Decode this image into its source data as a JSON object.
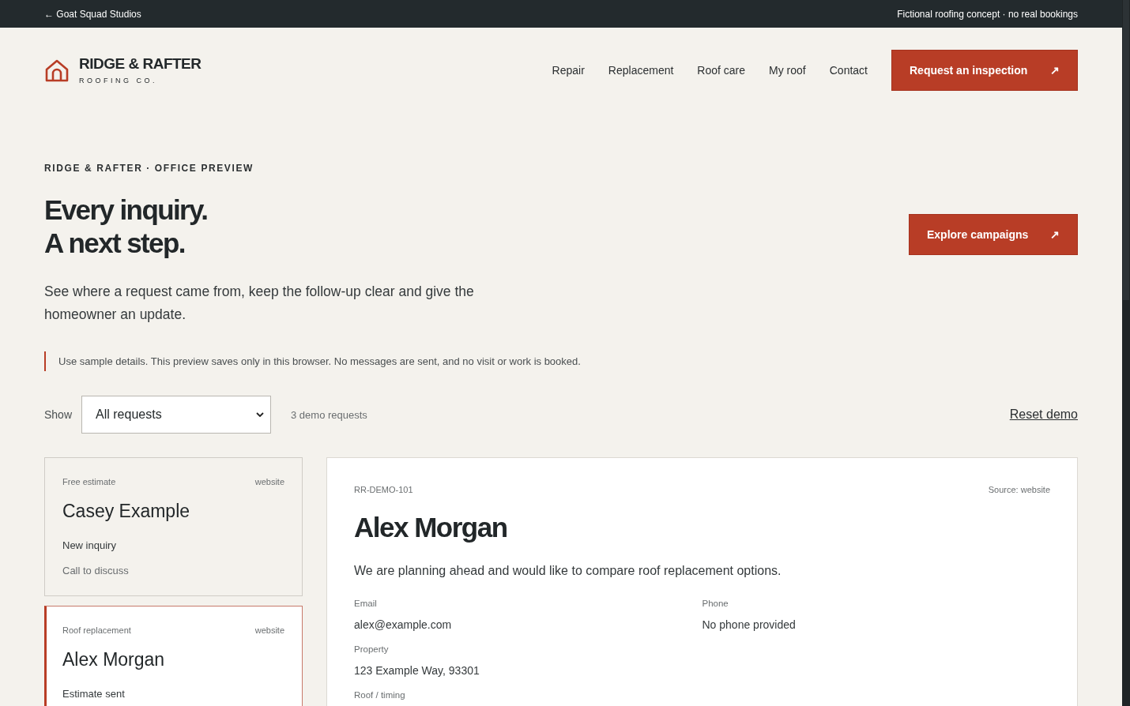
{
  "top_bar": {
    "back_link": "← Goat Squad Studios",
    "note": "Fictional roofing concept · no real bookings"
  },
  "header": {
    "brand": {
      "name": "RIDGE & RAFTER",
      "tagline": "ROOFING CO."
    },
    "nav": [
      "Repair",
      "Replacement",
      "Roof care",
      "My roof",
      "Contact"
    ],
    "cta": {
      "label": "Request an inspection",
      "icon": "↗"
    }
  },
  "hero": {
    "eyebrow": "RIDGE & RAFTER · OFFICE PREVIEW",
    "title_lines": [
      "Every inquiry.",
      "A next step."
    ],
    "intro": "See where a request came from, keep the follow-up clear and give the homeowner an update.",
    "button": {
      "label": "Explore campaigns",
      "icon": "↗"
    }
  },
  "notice": "Use sample details. This preview saves only in this browser. No messages are sent, and no visit or work is booked.",
  "filter": {
    "label": "Show",
    "value": "All requests",
    "count": "3 demo requests",
    "reset": "Reset demo"
  },
  "requests": [
    {
      "type": "Free estimate",
      "source": "website",
      "name": "Casey Example",
      "status": "New inquiry",
      "next": "Call to discuss",
      "selected": false
    },
    {
      "type": "Roof replacement",
      "source": "website",
      "name": "Alex Morgan",
      "status": "Estimate sent",
      "selected": true
    }
  ],
  "detail": {
    "id": "RR-DEMO-101",
    "source": "Source: website",
    "name": "Alex Morgan",
    "message": "We are planning ahead and would like to compare roof replacement options.",
    "fields": [
      {
        "label": "Email",
        "value": "alex@example.com"
      },
      {
        "label": "Phone",
        "value": "No phone provided"
      },
      {
        "label": "Property",
        "value": "123 Example Way, 93301"
      },
      {
        "label": "Roof / timing"
      }
    ]
  }
}
